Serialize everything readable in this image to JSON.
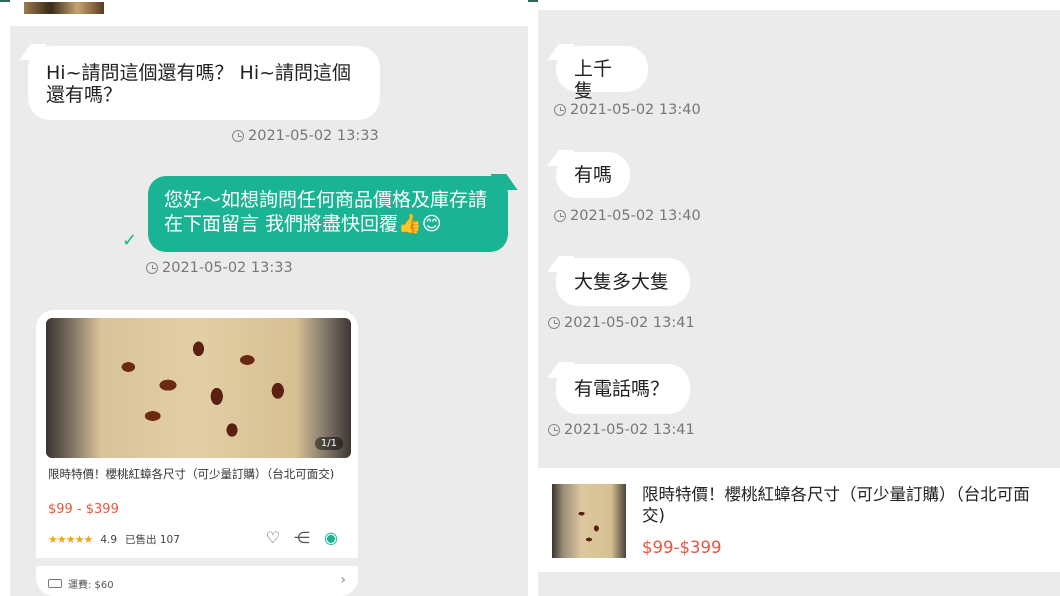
{
  "left_chat": {
    "msg1": {
      "text": "Hi~請問這個還有嗎？ Hi~請問這個還有嗎？",
      "time": "2021-05-02 13:33"
    },
    "msg2": {
      "text": "您好～如想詢問任何商品價格及庫存請在下面留言 我們將盡快回覆👍😊",
      "time": "2021-05-02 13:33"
    },
    "product_card": {
      "image_badge": "1/1",
      "title": "限時特價！櫻桃紅蟑各尺寸（可少量訂購）（台北可面交)",
      "price": "$99 - $399",
      "rating": "4.9",
      "sold": "已售出 107",
      "shipping": "運費: $60",
      "stars": "★★★★★"
    }
  },
  "right_chat": {
    "messages": [
      {
        "text": "上千隻",
        "time": "2021-05-02 13:40"
      },
      {
        "text": "有嗎",
        "time": "2021-05-02 13:40"
      },
      {
        "text": "大隻多大隻",
        "time": "2021-05-02 13:41"
      },
      {
        "text": "有電話嗎？",
        "time": "2021-05-02 13:41"
      }
    ],
    "product": {
      "title": "限時特價！櫻桃紅蟑各尺寸（可少量訂購）（台北可面交)",
      "price": "$99-$399"
    }
  },
  "icons": {
    "clock": "clock-icon",
    "check": "check-icon",
    "heart": "heart-icon",
    "share": "share-icon",
    "chat": "chat-icon",
    "truck": "truck-icon",
    "chevron": "chevron-right-icon"
  },
  "colors": {
    "sent_bubble": "#1ab394",
    "price": "#e8563f",
    "background": "#ebebeb"
  }
}
